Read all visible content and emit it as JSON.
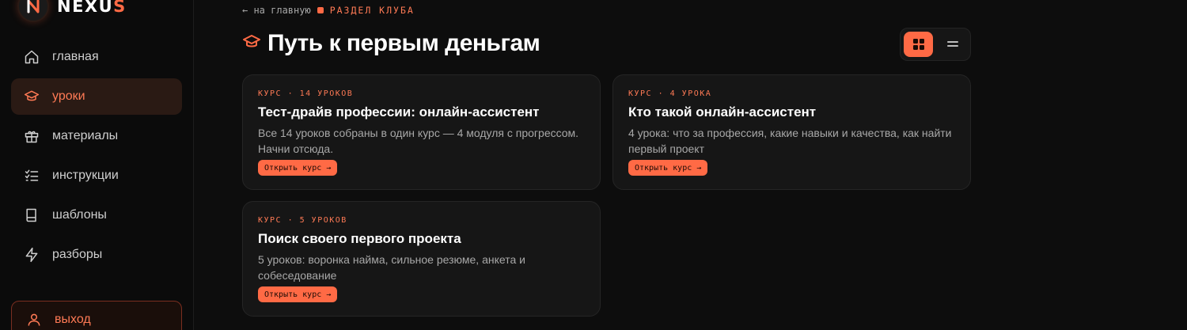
{
  "app": {
    "logo_main": "NEXU",
    "logo_accent": "S"
  },
  "sidebar": {
    "items": [
      {
        "label": "главная",
        "icon": "home-icon",
        "active": false
      },
      {
        "label": "уроки",
        "icon": "graduation-cap-icon",
        "active": true
      },
      {
        "label": "материалы",
        "icon": "gift-icon",
        "active": false
      },
      {
        "label": "инструкции",
        "icon": "checklist-icon",
        "active": false
      },
      {
        "label": "шаблоны",
        "icon": "book-icon",
        "active": false
      },
      {
        "label": "разборы",
        "icon": "lightning-icon",
        "active": false
      }
    ],
    "logout_label": "выход"
  },
  "breadcrumb": {
    "back": "← на главную",
    "section": "РАЗДЕЛ КЛУБА"
  },
  "page": {
    "title": "Путь к первым деньгам"
  },
  "view_toggle": {
    "active": "grid"
  },
  "cards": [
    {
      "meta": "КУРС · 14 УРОКОВ",
      "title": "Тест-драйв профессии: онлайн-ассистент",
      "desc": "Все 14 уроков собраны в один курс — 4 модуля с прогрессом. Начни отсюда.",
      "button": "Открыть курс →"
    },
    {
      "meta": "КУРС · 4 УРОКА",
      "title": "Кто такой онлайн-ассистент",
      "desc": "4 урока: что за профессия, какие навыки и качества, как найти первый проект",
      "button": "Открыть курс →"
    },
    {
      "meta": "КУРС · 5 УРОКОВ",
      "title": "Поиск своего первого проекта",
      "desc": "5 уроков: воронка найма, сильное резюме, анкета и собеседование",
      "button": "Открыть курс →"
    }
  ],
  "colors": {
    "accent": "#ff6a45",
    "background": "#0d0d0d",
    "card": "#161616"
  }
}
